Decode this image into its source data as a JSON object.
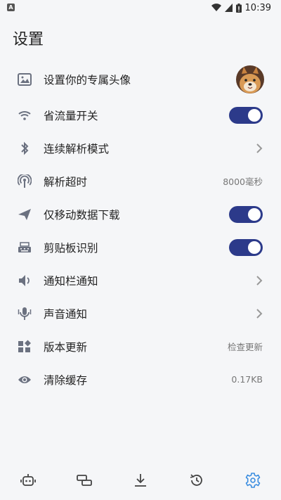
{
  "status_bar": {
    "app_badge": "A",
    "time": "10:39"
  },
  "page": {
    "title": "设置"
  },
  "settings": {
    "items": [
      {
        "label": "设置你的专属头像",
        "icon": "image-icon",
        "control": "avatar"
      },
      {
        "label": "省流量开关",
        "icon": "wifi-icon",
        "control": "toggle",
        "on": true
      },
      {
        "label": "连续解析模式",
        "icon": "bluetooth-icon",
        "control": "chevron"
      },
      {
        "label": "解析超时",
        "icon": "antenna-icon",
        "control": "value",
        "value": "8000毫秒"
      },
      {
        "label": "仅移动数据下载",
        "icon": "send-icon",
        "control": "toggle",
        "on": true
      },
      {
        "label": "剪贴板识别",
        "icon": "keyboard-icon",
        "control": "toggle",
        "on": true
      },
      {
        "label": "通知栏通知",
        "icon": "speaker-icon",
        "control": "chevron"
      },
      {
        "label": "声音通知",
        "icon": "mic-icon",
        "control": "chevron"
      },
      {
        "label": "版本更新",
        "icon": "widgets-icon",
        "control": "value",
        "value": "检查更新"
      },
      {
        "label": "清除缓存",
        "icon": "eye-icon",
        "control": "value",
        "value": "0.17KB"
      }
    ]
  },
  "bottom_nav": {
    "items": [
      {
        "icon": "robot-icon",
        "active": false
      },
      {
        "icon": "link-icon",
        "active": false
      },
      {
        "icon": "download-icon",
        "active": false
      },
      {
        "icon": "history-icon",
        "active": false
      },
      {
        "icon": "settings-gear-icon",
        "active": true
      }
    ]
  },
  "colors": {
    "accent": "#2c3a8a",
    "active_nav": "#3b8de0",
    "icon_gray": "#6b7180",
    "background": "#f5f6f8"
  }
}
